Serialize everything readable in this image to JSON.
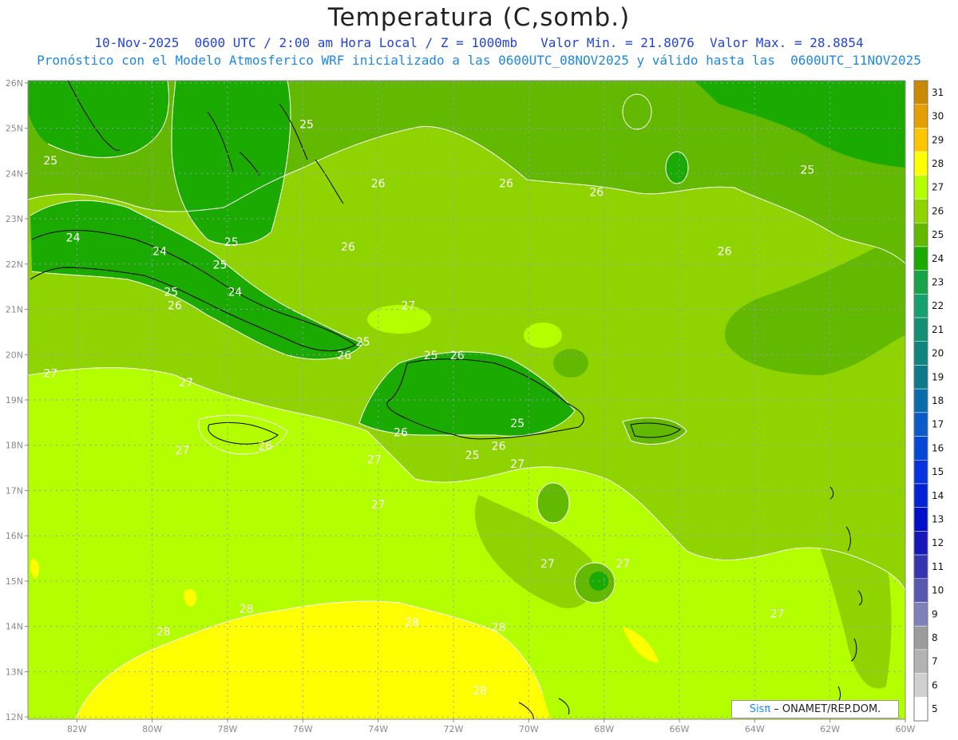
{
  "header": {
    "title": "Temperatura (C,somb.)",
    "subtitle_1": "10-Nov-2025  0600 UTC / 2:00 am Hora Local / Z = 1000mb   Valor Min. = 21.8076  Valor Max. = 28.8854",
    "subtitle_2": "Pronóstico con el Modelo Atmosferico WRF inicializado a las 0600UTC_08NOV2025 y válido hasta las  0600UTC_11NOV2025"
  },
  "axes": {
    "lat_labels": [
      "26N",
      "25N",
      "24N",
      "23N",
      "22N",
      "21N",
      "20N",
      "19N",
      "18N",
      "17N",
      "16N",
      "15N",
      "14N",
      "13N",
      "12N"
    ],
    "lon_labels": [
      "82W",
      "80W",
      "78W",
      "76W",
      "74W",
      "72W",
      "70W",
      "68W",
      "66W",
      "64W",
      "62W",
      "60W"
    ]
  },
  "colorbar": {
    "levels": [
      "31",
      "30",
      "29",
      "28",
      "27",
      "26",
      "25",
      "24",
      "23",
      "22",
      "21",
      "20",
      "19",
      "18",
      "17",
      "16",
      "15",
      "14",
      "13",
      "12",
      "11",
      "10",
      "9",
      "8",
      "7",
      "6",
      "5"
    ],
    "colors": [
      "#c98a00",
      "#e69f00",
      "#ffc600",
      "#ffff00",
      "#b3ff00",
      "#8fd400",
      "#63b800",
      "#1aaa00",
      "#18a24a",
      "#16a070",
      "#138f75",
      "#10857f",
      "#0d7a8a",
      "#0a6cab",
      "#0a5bc8",
      "#0747d8",
      "#0533dd",
      "#0222d5",
      "#0010c8",
      "#1818b8",
      "#3535b0",
      "#5858b0",
      "#8080b8",
      "#9c9c9c",
      "#b3b3b3",
      "#d0d0d0",
      "#ffffff"
    ]
  },
  "contour_labels": [
    {
      "text": "25",
      "lon": -82.7,
      "lat": 24.2
    },
    {
      "text": "24",
      "lon": -82.1,
      "lat": 22.5
    },
    {
      "text": "24",
      "lon": -79.8,
      "lat": 22.2
    },
    {
      "text": "25",
      "lon": -77.9,
      "lat": 22.4
    },
    {
      "text": "25",
      "lon": -78.2,
      "lat": 21.9
    },
    {
      "text": "24",
      "lon": -77.8,
      "lat": 21.3
    },
    {
      "text": "25",
      "lon": -79.5,
      "lat": 21.3
    },
    {
      "text": "26",
      "lon": -79.4,
      "lat": 21.0
    },
    {
      "text": "25",
      "lon": -75.9,
      "lat": 25.0
    },
    {
      "text": "26",
      "lon": -74.0,
      "lat": 23.7
    },
    {
      "text": "26",
      "lon": -74.8,
      "lat": 22.3
    },
    {
      "text": "27",
      "lon": -73.2,
      "lat": 21.0
    },
    {
      "text": "25",
      "lon": -74.4,
      "lat": 20.2
    },
    {
      "text": "26",
      "lon": -74.9,
      "lat": 19.9
    },
    {
      "text": "25",
      "lon": -72.6,
      "lat": 19.9
    },
    {
      "text": "26",
      "lon": -71.9,
      "lat": 19.9
    },
    {
      "text": "25",
      "lon": -70.3,
      "lat": 18.4
    },
    {
      "text": "26",
      "lon": -73.4,
      "lat": 18.2
    },
    {
      "text": "26",
      "lon": -70.8,
      "lat": 17.9
    },
    {
      "text": "25",
      "lon": -71.5,
      "lat": 17.7
    },
    {
      "text": "27",
      "lon": -70.3,
      "lat": 17.5
    },
    {
      "text": "27",
      "lon": -74.1,
      "lat": 17.6
    },
    {
      "text": "26",
      "lon": -77.0,
      "lat": 17.9
    },
    {
      "text": "27",
      "lon": -79.2,
      "lat": 17.8
    },
    {
      "text": "27",
      "lon": -82.7,
      "lat": 19.5
    },
    {
      "text": "27",
      "lon": -79.1,
      "lat": 19.3
    },
    {
      "text": "27",
      "lon": -74.0,
      "lat": 16.6
    },
    {
      "text": "26",
      "lon": -70.6,
      "lat": 23.7
    },
    {
      "text": "26",
      "lon": -68.2,
      "lat": 23.5
    },
    {
      "text": "25",
      "lon": -62.6,
      "lat": 24.0
    },
    {
      "text": "26",
      "lon": -64.8,
      "lat": 22.2
    },
    {
      "text": "27",
      "lon": -69.5,
      "lat": 15.3
    },
    {
      "text": "27",
      "lon": -67.5,
      "lat": 15.3
    },
    {
      "text": "27",
      "lon": -63.4,
      "lat": 14.2
    },
    {
      "text": "28",
      "lon": -77.5,
      "lat": 14.3
    },
    {
      "text": "28",
      "lon": -79.7,
      "lat": 13.8
    },
    {
      "text": "28",
      "lon": -73.1,
      "lat": 14.0
    },
    {
      "text": "28",
      "lon": -70.8,
      "lat": 13.9
    },
    {
      "text": "28",
      "lon": -71.3,
      "lat": 12.5
    }
  ],
  "credit": {
    "brand": "Sisπ",
    "text": " – ONAMET/REP.DOM."
  }
}
